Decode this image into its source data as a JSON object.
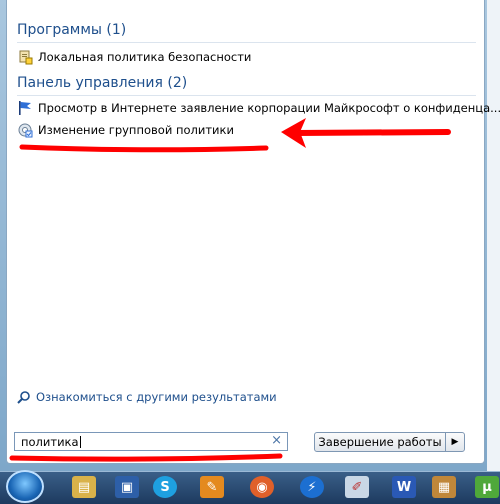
{
  "programs": {
    "header": "Программы (1)",
    "items": [
      {
        "label": "Локальная политика безопасности",
        "icon": "local-security-policy-icon"
      }
    ]
  },
  "control_panel": {
    "header": "Панель управления (2)",
    "items": [
      {
        "label": "Просмотр в Интернете заявление корпорации Майкрософт о конфиденца...",
        "icon": "blue-flag-icon"
      },
      {
        "label": "Изменение групповой политики",
        "icon": "group-policy-icon"
      }
    ]
  },
  "see_more": {
    "label": "Ознакомиться с другими результатами",
    "icon": "search-icon"
  },
  "search": {
    "value": "политика",
    "clear_icon": "close-icon"
  },
  "shutdown": {
    "label": "Завершение работы",
    "arrow_icon": "arrow-right-icon"
  },
  "taskbar": {
    "icons": [
      "start-orb-icon",
      "explorer-icon",
      "floppy-save-icon",
      "skype-icon",
      "pen-app-icon",
      "firefox-icon",
      "lightning-app-icon",
      "paint-icon",
      "word-icon",
      "image-icon",
      "utorrent-icon"
    ]
  },
  "annotation_color": "#ff0000"
}
